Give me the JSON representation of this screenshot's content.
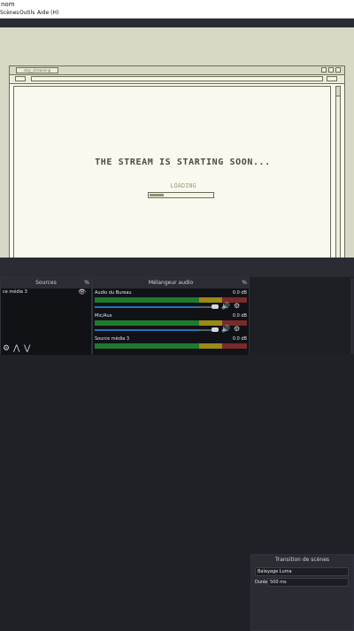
{
  "window": {
    "title": "nom"
  },
  "menu": [
    {
      "label": "Scènes"
    },
    {
      "label": "Outils"
    },
    {
      "label": "Aide (H)"
    }
  ],
  "preview": {
    "tab_label": "stay_streaming",
    "heading": "THE STREAM IS STARTING SOON...",
    "loading_label": "LOADING",
    "loading_fraction": 0.22
  },
  "panels": {
    "sources": {
      "title": "Sources",
      "pct": "%",
      "items": [
        {
          "label": "ce média 3"
        }
      ]
    },
    "mixer": {
      "title": "Mélangeur audio",
      "pct": "%",
      "channels": [
        {
          "name": "Audio du Bureau",
          "db": "0.0 dB"
        },
        {
          "name": "Mic/Aux",
          "db": "0.0 dB"
        },
        {
          "name": "Source média 3",
          "db": "0.0 dB"
        }
      ]
    },
    "transitions": {
      "title": "Transition de scènes",
      "selected_transition": "Balayage Luma",
      "duration_label": "Durée",
      "duration_value": "500 ms"
    }
  },
  "icons": {
    "eye": "eye-icon",
    "gear": "gear-icon",
    "up": "arrow-up-icon",
    "down": "arrow-down-icon",
    "speaker": "speaker-icon",
    "settings": "gear-icon"
  },
  "colors": {
    "preview_bg": "#d7d9c6",
    "window_bg": "#fbf9ef",
    "text_dark": "#4e4c42",
    "meter_green": "#1f7a2f",
    "meter_yellow": "#9a8a17",
    "meter_red": "#7b2a2a",
    "slider_blue": "#2b6fb4"
  }
}
